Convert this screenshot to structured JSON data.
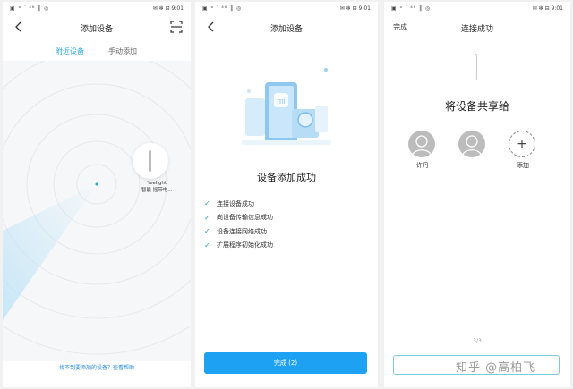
{
  "status_bar": {
    "left": "▣ ᵒ ᐝ ⁴⁶ ‖ ◎",
    "right": "✉ ✻ ⊟ 9:01"
  },
  "panel1": {
    "title": "添加设备",
    "tabs": [
      "附近设备",
      "手动添加"
    ],
    "device": {
      "line1": "Yeelight",
      "line2": "智能 摇带电..."
    },
    "help": "找不到要添加的设备？查看帮助"
  },
  "panel2": {
    "title": "添加设备",
    "heading": "设备添加成功",
    "steps": [
      "连接设备成功",
      "向设备传输信息成功",
      "设备连接网络成功",
      "扩展程序初始化成功"
    ],
    "done_button": "完成 (2)"
  },
  "panel3": {
    "left_button": "完成",
    "title": "连接成功",
    "heading": "将设备共享给",
    "users": [
      {
        "name": "许丹"
      },
      {
        "name": ""
      }
    ],
    "add_label": "添加",
    "page_indicator": "3/3",
    "watermark": "知乎 @高柏飞"
  },
  "colors": {
    "accent": "#1da1f2",
    "tab_active": "#2aa7d9",
    "link": "#2a8fd9"
  }
}
